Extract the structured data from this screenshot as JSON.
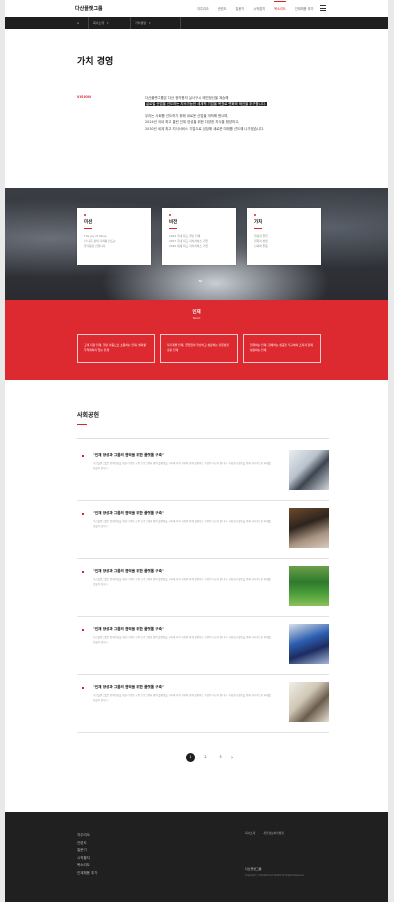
{
  "header": {
    "logo": "다산플랫그룹",
    "nav": [
      "자주리오",
      "관련도",
      "질문기",
      "시작할지",
      "목소리도",
      "인재채용 추가"
    ],
    "active_index": 4,
    "sub_items": [
      "회사소개",
      "가치경영"
    ]
  },
  "page": {
    "title": "가치 경영",
    "vision_label": "VISION",
    "intro": [
      "다산플랫그룹은 다산 정약용의 실사구시 애민정신을 계승해",
      "글로벌 산업을 선도하는 지속가능한 세계적 기업을 목표로 변화와 혁신을 추구합니다.",
      "우리는 사회를 선도하기 위해 새로운 산업을 개척해 왔으며,",
      "2024년 국내 최고 클린 인재 양성을 위한 다양한 지식을 함양하고,",
      "2030년 세계 최고 지식서비스 기업으로 성장해 새로운 미래를 선도해 나가겠습니다."
    ]
  },
  "values": [
    {
      "title": "미션",
      "lines": [
        "The Joy of Value",
        "더 나은 삶의 가치를 만드는",
        "즐거움을 전합니다"
      ]
    },
    {
      "title": "비전",
      "lines": [
        "2024 국내 최고 클린 인재",
        "2027 국내 최고 지식서비스 기업",
        "2030 세계 최고 지식서비스 기업"
      ]
    },
    {
      "title": "가치",
      "lines": [
        "열정과 몰입",
        "협력과 상생",
        "신뢰와 존중"
      ]
    }
  ],
  "red_band": {
    "title": "인재",
    "subtitle": "Talent",
    "boxes": [
      "고객 지향 인재, 열린 마음으로 소통하는 인재, 변화를 두려워하지 않는 인재",
      "자기계발 인재, 끊임없이 학습하고 성장하는 전문성을 갖춘 인재",
      "협력하는 인재, 함께하는 성공을 추구하며 조직과 함께 성장하는 인재"
    ]
  },
  "social": {
    "title": "사회공헌",
    "items": [
      {
        "title": "\"인재 양성과 그룹의 협력을 위한 플랫폼 구축\"",
        "body": "다산플랫그룹은 인재양성을 위한 다양한 교육 프로그램과 협력 플랫폼을 구축해 지역 사회와 함께 성장하는 기업이 되고자 합니다. 사회공헌 활동을 통해 지속가능한 미래를 만들어 갑니다.",
        "image": "tablet-work-photo"
      },
      {
        "title": "\"인재 양성과 그룹의 협력을 위한 플랫폼 구축\"",
        "body": "다산플랫그룹은 인재양성을 위한 다양한 교육 프로그램과 협력 플랫폼을 구축해 지역 사회와 함께 성장하는 기업이 되고자 합니다. 사회공헌 활동을 통해 지속가능한 미래를 만들어 갑니다.",
        "image": "meeting-photo"
      },
      {
        "title": "\"인재 양성과 그룹의 협력을 위한 플랫폼 구축\"",
        "body": "다산플랫그룹은 인재양성을 위한 다양한 교육 프로그램과 협력 플랫폼을 구축해 지역 사회와 함께 성장하는 기업이 되고자 합니다. 사회공헌 활동을 통해 지속가능한 미래를 만들어 갑니다.",
        "image": "green-field-photo"
      },
      {
        "title": "\"인재 양성과 그룹의 협력을 위한 플랫폼 구축\"",
        "body": "다산플랫그룹은 인재양성을 위한 다양한 교육 프로그램과 협력 플랫폼을 구축해 지역 사회와 함께 성장하는 기업이 되고자 합니다. 사회공헌 활동을 통해 지속가능한 미래를 만들어 갑니다.",
        "image": "lab-photo"
      },
      {
        "title": "\"인재 양성과 그룹의 협력을 위한 플랫폼 구축\"",
        "body": "다산플랫그룹은 인재양성을 위한 다양한 교육 프로그램과 협력 플랫폼을 구축해 지역 사회와 함께 성장하는 기업이 되고자 합니다. 사회공헌 활동을 통해 지속가능한 미래를 만들어 갑니다.",
        "image": "writing-photo"
      }
    ]
  },
  "pagination": {
    "pages": [
      "1",
      "2",
      "3"
    ],
    "current": "1",
    "next": "›"
  },
  "footer": {
    "nav": [
      "자주리오",
      "관련도",
      "질문기",
      "시작할지",
      "목소리도",
      "인재채용 추가"
    ],
    "links": [
      "회사소개",
      "개인정보처리방침"
    ],
    "logo": "다산플랫그룹",
    "copy": "Copyright ⓒ DASAN PLAT GROUP All Rights Reserved."
  },
  "colors": {
    "accent": "#d8262f",
    "dark": "#1f1f1f",
    "red_band": "#dd2a31"
  }
}
